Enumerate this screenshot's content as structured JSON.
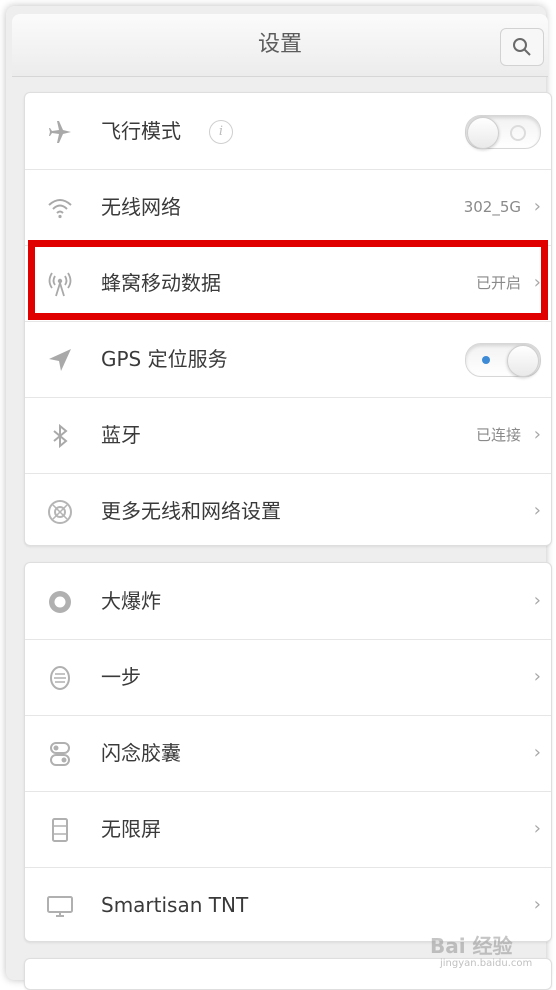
{
  "header": {
    "title": "设置"
  },
  "group1": [
    {
      "label": "飞行模式",
      "icon": "airplane-icon",
      "control": "toggle",
      "state": "off",
      "info": "i"
    },
    {
      "label": "无线网络",
      "icon": "wifi-icon",
      "value": "302_5G"
    },
    {
      "label": "蜂窝移动数据",
      "icon": "cellular-icon",
      "value": "已开启"
    },
    {
      "label": "GPS 定位服务",
      "icon": "location-arrow-icon",
      "control": "toggle",
      "state": "on"
    },
    {
      "label": "蓝牙",
      "icon": "bluetooth-icon",
      "value": "已连接"
    },
    {
      "label": "更多无线和网络设置",
      "icon": "more-network-icon"
    }
  ],
  "group2": [
    {
      "label": "大爆炸",
      "icon": "big-bang-icon"
    },
    {
      "label": "一步",
      "icon": "one-step-icon"
    },
    {
      "label": "闪念胶囊",
      "icon": "capsule-icon"
    },
    {
      "label": "无限屏",
      "icon": "infinite-screen-icon"
    },
    {
      "label": "Smartisan TNT",
      "icon": "monitor-icon"
    }
  ],
  "chevron": "›",
  "watermark": {
    "text": "Bai 经验",
    "url": "jingyan.baidu.com"
  },
  "colors": {
    "highlight": "#e00000",
    "toggle_dot": "#3d8bd6"
  }
}
